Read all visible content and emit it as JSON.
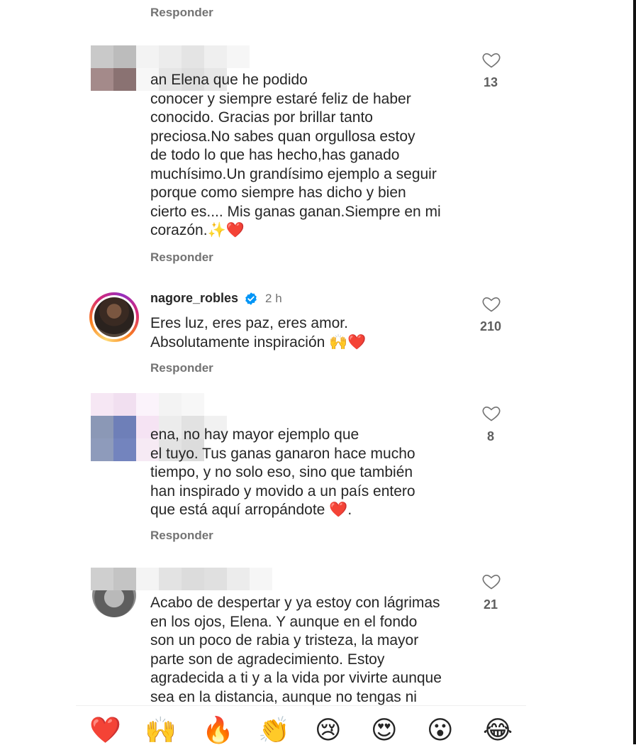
{
  "reply_label": "Responder",
  "comments": [
    {
      "id": "c1",
      "username": "",
      "text_lines": [
        "an Elena que he podido",
        "conocer y siempre estaré feliz de haber",
        "conocido. Gracias por brillar tanto",
        "preciosa.No sabes quan orgullosa estoy",
        "de todo lo que has hecho,has ganado",
        "muchísimo.Un grandísimo ejemplo a seguir",
        "porque como siempre has dicho y bien",
        "cierto es.... Mis ganas ganan.Siempre en mi",
        "corazón.✨❤️"
      ],
      "likes": "13"
    },
    {
      "id": "c2",
      "username": "nagore_robles",
      "verified": true,
      "time": "2 h",
      "text_lines": [
        "Eres luz, eres paz, eres amor.",
        "Absolutamente inspiración 🙌❤️"
      ],
      "likes": "210"
    },
    {
      "id": "c3",
      "username": "",
      "text_lines": [
        "ena, no hay mayor ejemplo que",
        "el tuyo. Tus ganas ganaron hace mucho",
        "tiempo, y no solo eso, sino que también",
        "han inspirado y movido a un país entero",
        "que está aquí arropándote ❤️."
      ],
      "likes": "8"
    },
    {
      "id": "c4",
      "username": "",
      "text_lines": [
        "Acabo de despertar y ya estoy con lágrimas",
        "en los ojos, Elena. Y aunque en el fondo",
        "son un poco de rabia y tristeza, la mayor",
        "parte son de agradecimiento. Estoy",
        "agradecida a ti y a la vida por vivirte aunque",
        "sea en la distancia, aunque no tengas ni"
      ],
      "likes": "21"
    }
  ],
  "reactions": [
    "❤️",
    "🙌",
    "🔥",
    "👏",
    "😢",
    "😍",
    "😮",
    "😂"
  ],
  "colors": {
    "verified_blue": "#0095f6",
    "heart_red": "#ed4956",
    "muted_text": "#737373"
  },
  "icons": {
    "like": "heart-outline-icon",
    "verified": "verified-badge-icon"
  }
}
